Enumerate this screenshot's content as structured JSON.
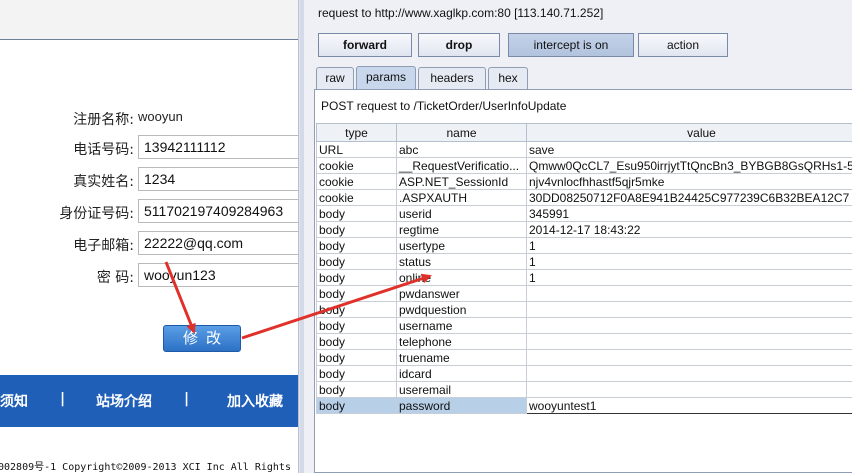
{
  "webpage": {
    "form": {
      "username_label": "注册名称:",
      "username_value": "wooyun",
      "phone_label": "电话号码:",
      "phone_value": "13942111112",
      "realname_label": "真实姓名:",
      "realname_value": "1234",
      "idcard_label": "身份证号码:",
      "idcard_value": "511702197409284963",
      "email_label": "电子邮箱:",
      "email_value": "22222@qq.com",
      "password_label": "密  码:",
      "password_value": "wooyun123",
      "submit_label": "修改"
    },
    "nav": {
      "item1": "须知",
      "sep1": "|",
      "item2": "站场介绍",
      "sep2": "|",
      "item3": "加入收藏"
    },
    "footer": "002809号-1 Copyright©2009-2013 XCI Inc All Rights"
  },
  "proxy": {
    "request_info": "request to http://www.xaglkp.com:80  [113.140.71.252]",
    "buttons": {
      "forward": "forward",
      "drop": "drop",
      "intercept": "intercept is on",
      "action": "action"
    },
    "tabs": [
      "raw",
      "params",
      "headers",
      "hex"
    ],
    "post_line": "POST request to /TicketOrder/UserInfoUpdate",
    "columns": {
      "type": "type",
      "name": "name",
      "value": "value"
    },
    "rows": [
      {
        "type": "URL",
        "name": "abc",
        "value": "save"
      },
      {
        "type": "cookie",
        "name": "__RequestVerificatio...",
        "value": "Qmww0QcCL7_Esu950irrjytTtQncBn3_BYBGB8GsQRHs1-5"
      },
      {
        "type": "cookie",
        "name": "ASP.NET_SessionId",
        "value": "njv4vnlocfhhastf5qjr5mke"
      },
      {
        "type": "cookie",
        "name": ".ASPXAUTH",
        "value": "30DD08250712F0A8E941B24425C977239C6B32BEA12C7"
      },
      {
        "type": "body",
        "name": "userid",
        "value": "345991"
      },
      {
        "type": "body",
        "name": "regtime",
        "value": "2014-12-17 18:43:22"
      },
      {
        "type": "body",
        "name": "usertype",
        "value": "1"
      },
      {
        "type": "body",
        "name": "status",
        "value": "1"
      },
      {
        "type": "body",
        "name": "online",
        "value": "1"
      },
      {
        "type": "body",
        "name": "pwdanswer",
        "value": ""
      },
      {
        "type": "body",
        "name": "pwdquestion",
        "value": ""
      },
      {
        "type": "body",
        "name": "username",
        "value": ""
      },
      {
        "type": "body",
        "name": "telephone",
        "value": ""
      },
      {
        "type": "body",
        "name": "truename",
        "value": ""
      },
      {
        "type": "body",
        "name": "idcard",
        "value": ""
      },
      {
        "type": "body",
        "name": "useremail",
        "value": ""
      },
      {
        "type": "body",
        "name": "password",
        "value": "wooyuntest1"
      }
    ],
    "selected_row": 16
  },
  "colors": {
    "accent_blue": "#1f5fb8",
    "arrow_red": "#e0302a",
    "selected_row": "#b8cfe8"
  }
}
